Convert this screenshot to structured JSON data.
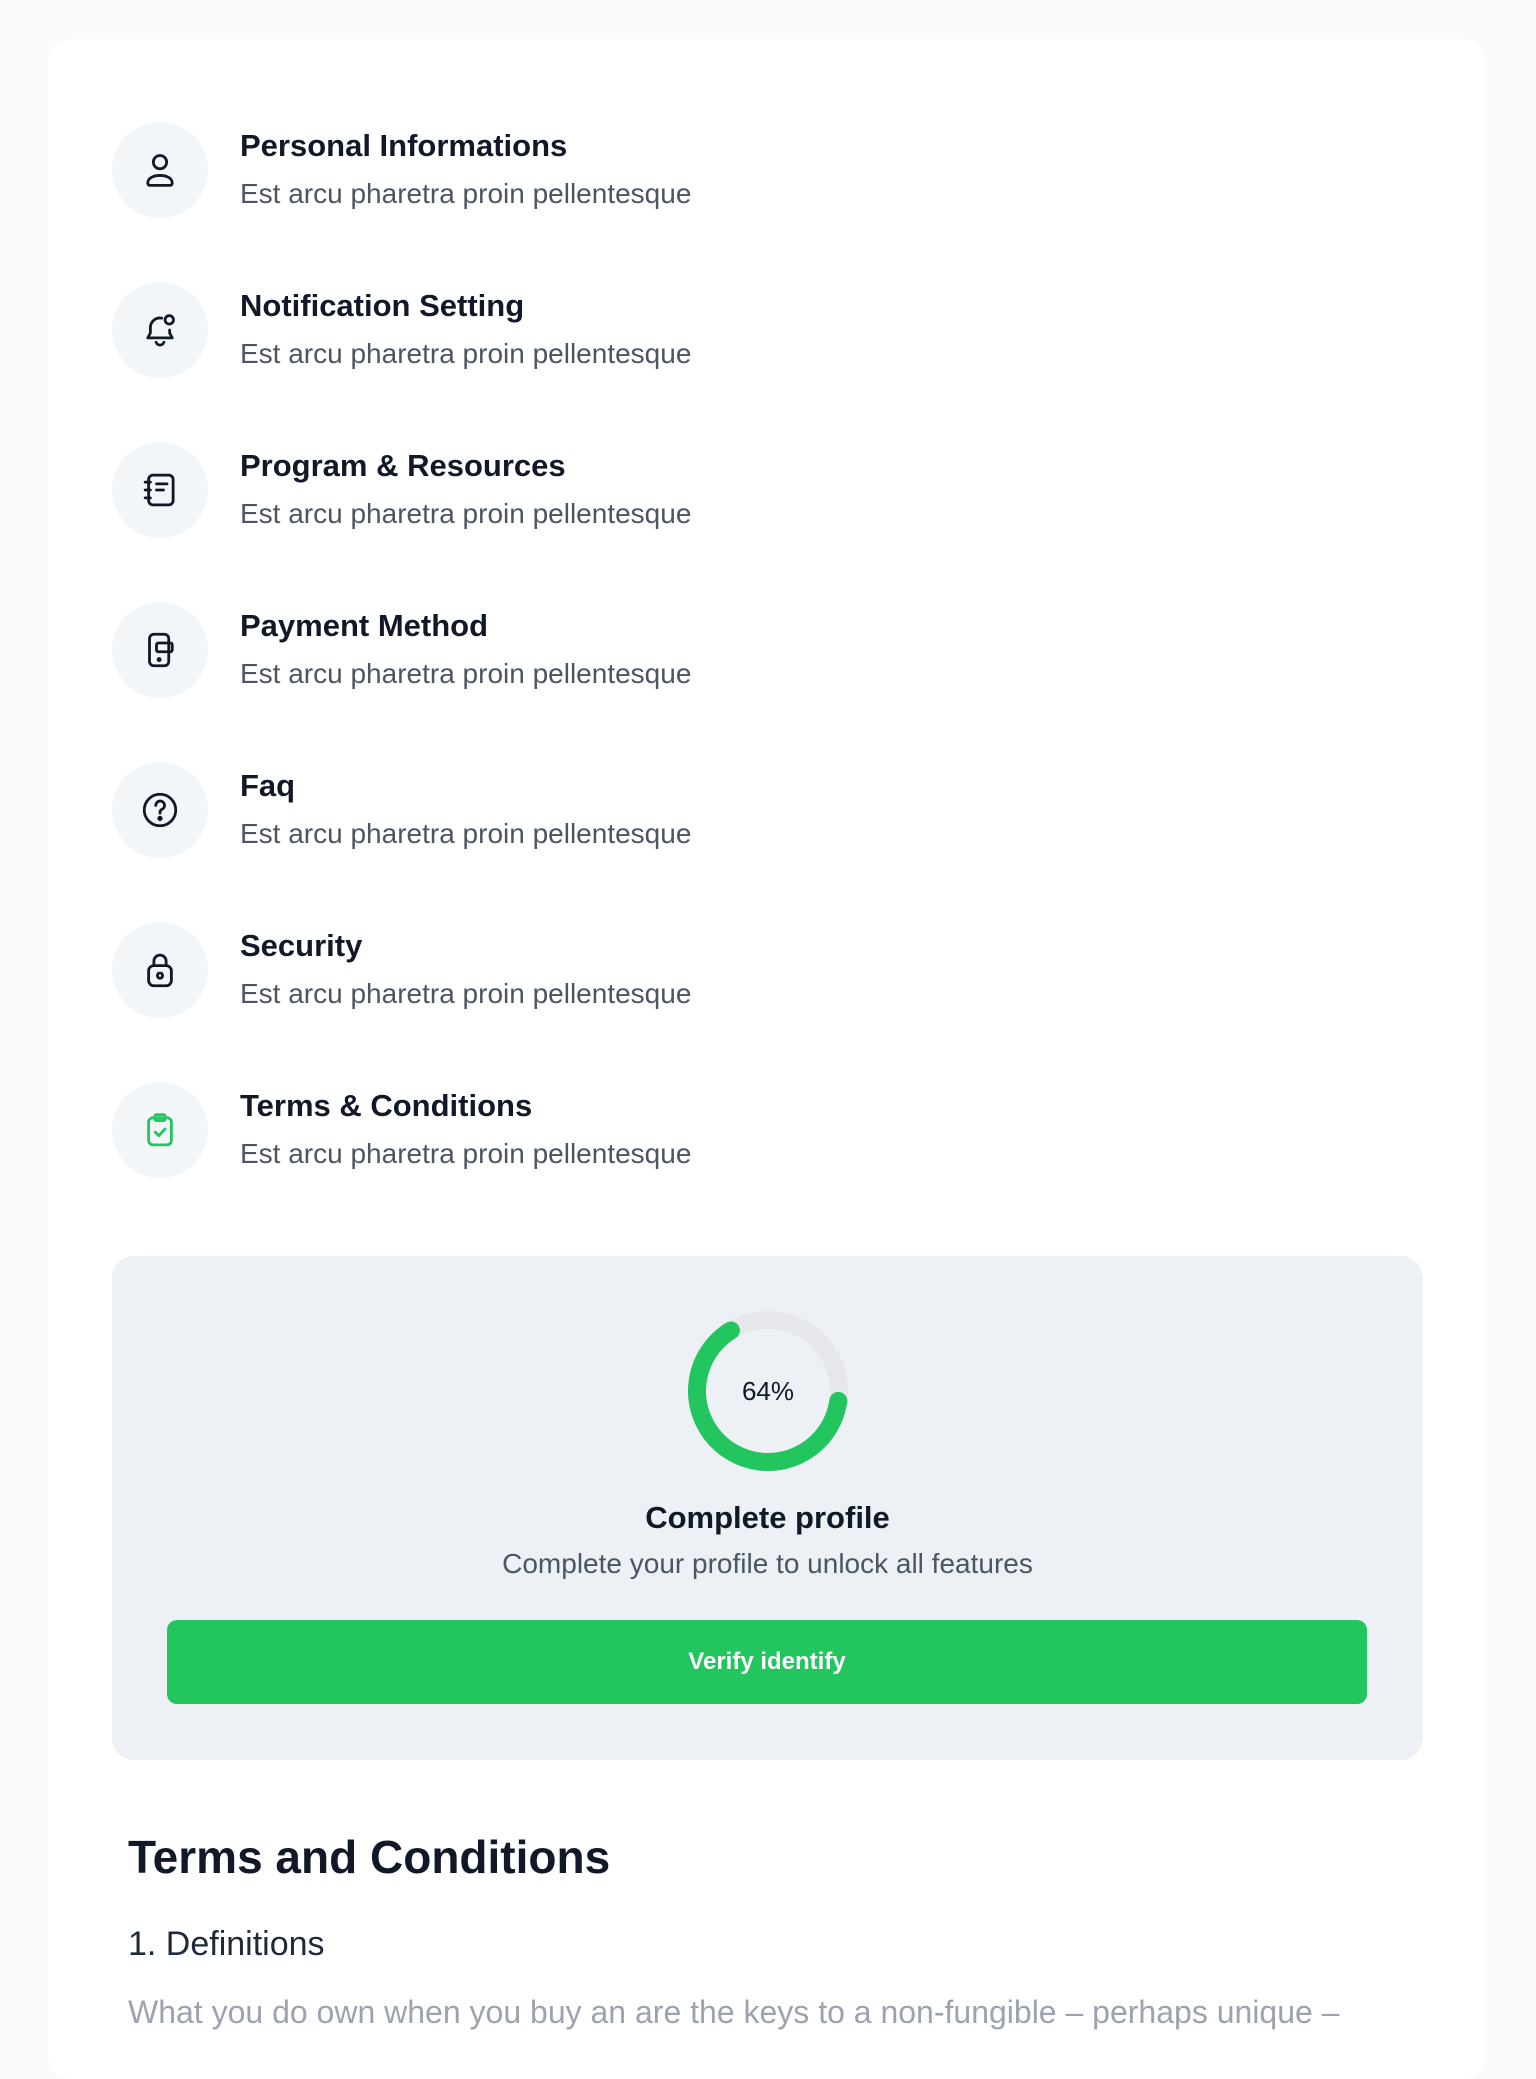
{
  "menu": {
    "items": [
      {
        "title": "Personal Informations",
        "subtitle": "Est arcu pharetra proin pellentesque",
        "icon": "user-icon"
      },
      {
        "title": "Notification Setting",
        "subtitle": "Est arcu pharetra proin pellentesque",
        "icon": "bell-icon"
      },
      {
        "title": "Program & Resources",
        "subtitle": "Est arcu pharetra proin pellentesque",
        "icon": "notebook-icon"
      },
      {
        "title": "Payment Method",
        "subtitle": "Est arcu pharetra proin pellentesque",
        "icon": "phone-card-icon"
      },
      {
        "title": "Faq",
        "subtitle": "Est arcu pharetra proin pellentesque",
        "icon": "question-icon"
      },
      {
        "title": "Security",
        "subtitle": "Est arcu pharetra proin pellentesque",
        "icon": "lock-icon"
      },
      {
        "title": "Terms & Conditions",
        "subtitle": "Est arcu pharetra proin pellentesque",
        "icon": "clipboard-check-icon"
      }
    ]
  },
  "profile": {
    "progress_label": "64%",
    "progress_value": 0.64,
    "title": "Complete profile",
    "subtitle": "Complete your profile to unlock all features",
    "button_label": "Verify identify"
  },
  "terms": {
    "heading": "Terms and Conditions",
    "section_title": "1. Definitions",
    "text": "What you do own when you buy an are the keys to a non-fungible – perhaps unique –"
  },
  "colors": {
    "accent": "#22c55e",
    "track": "#e5e7eb",
    "panel": "#edf1f5",
    "icon_bg": "#f3f6f9"
  }
}
